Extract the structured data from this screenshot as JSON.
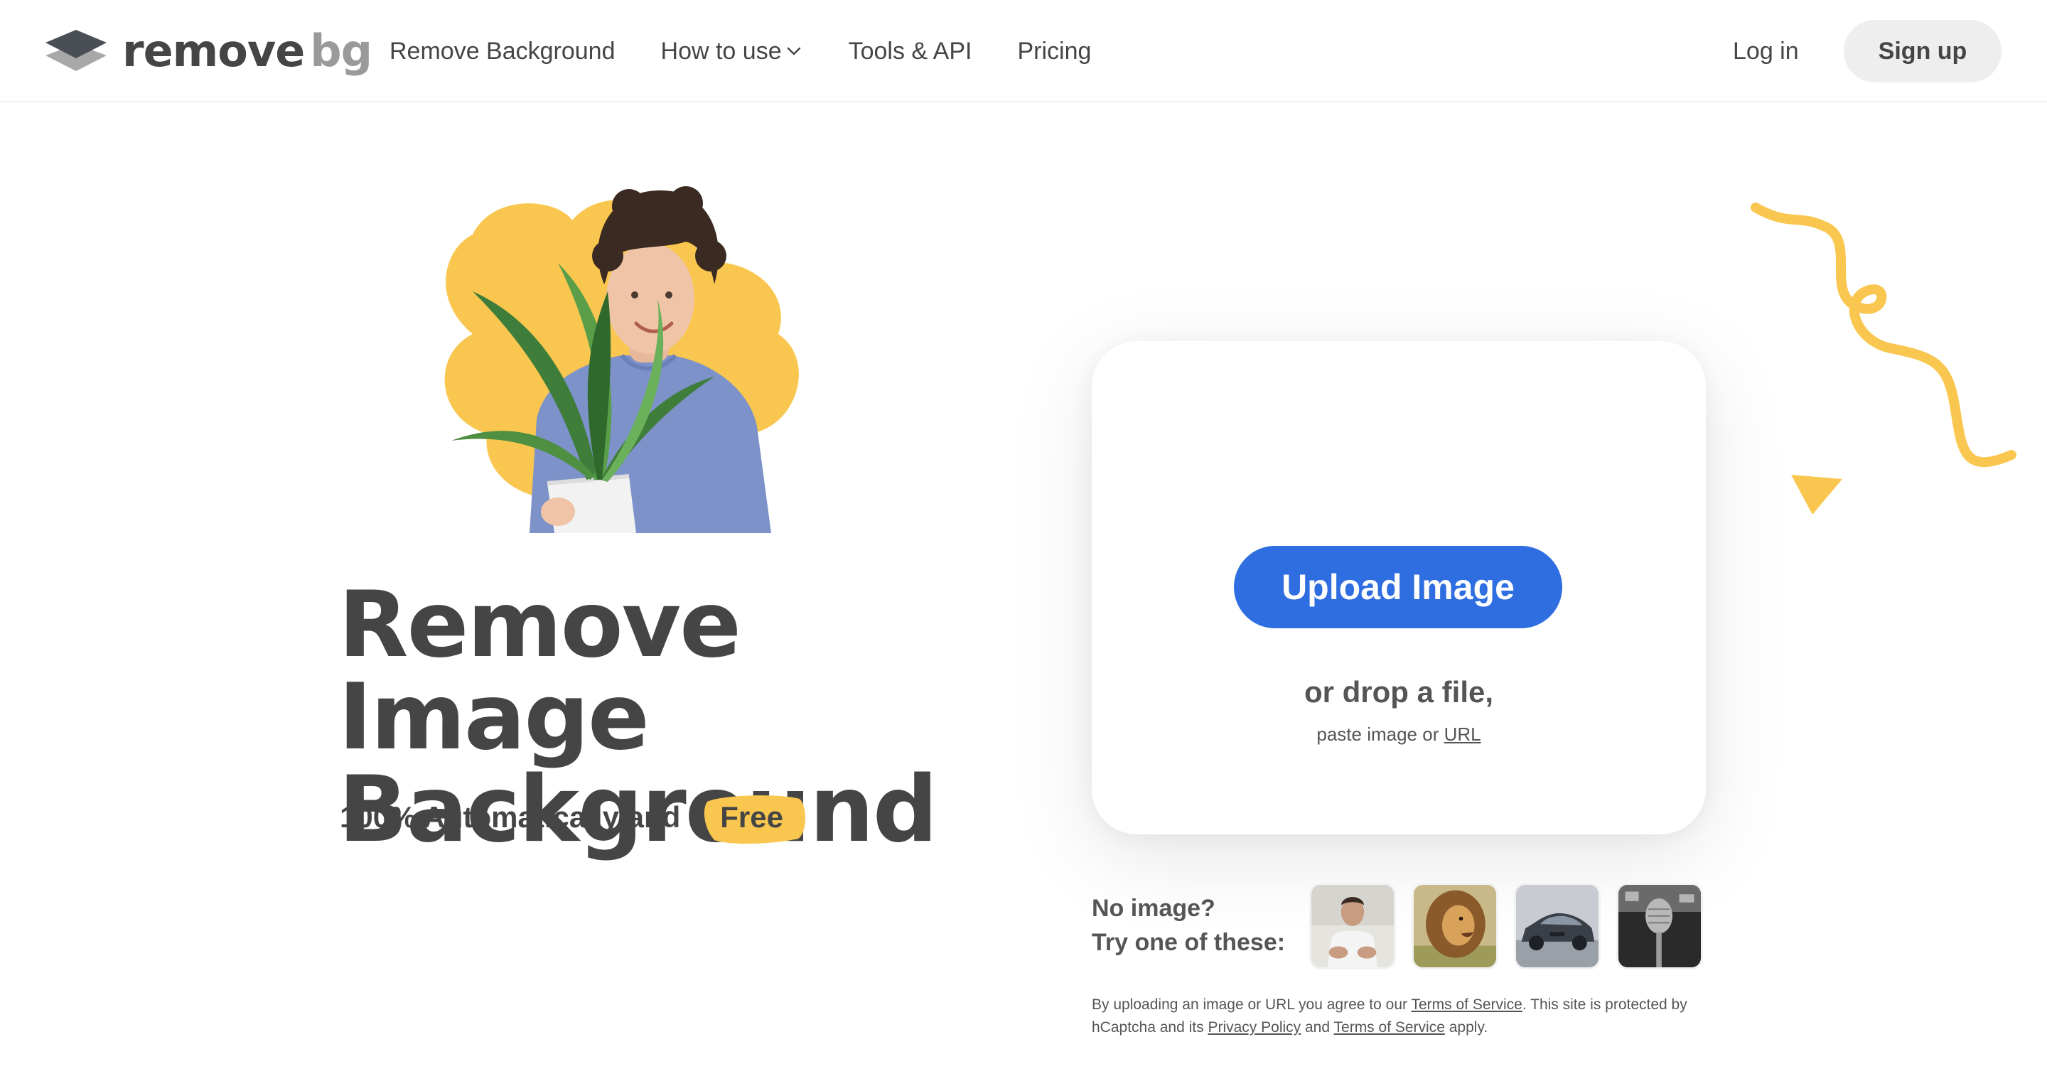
{
  "brand": {
    "logo_word1": "remove",
    "logo_word2": "bg",
    "accent_yellow": "#f9c74f",
    "primary_blue": "#2f6ee0"
  },
  "nav": {
    "items": [
      {
        "label": "Remove Background"
      },
      {
        "label": "How to use"
      },
      {
        "label": "Tools & API"
      },
      {
        "label": "Pricing"
      }
    ],
    "login_label": "Log in",
    "signup_label": "Sign up"
  },
  "hero": {
    "headline_line1": "Remove Image",
    "headline_line2": "Background",
    "sub_prefix": "100% Automatically and",
    "sub_highlight": "Free"
  },
  "upload": {
    "button_label": "Upload Image",
    "drop_text": "or drop a file,",
    "paste_prefix": "paste image or",
    "url_link": "URL"
  },
  "samples": {
    "line1": "No image?",
    "line2": "Try one of these:",
    "items": [
      {
        "icon": "person-sample-icon"
      },
      {
        "icon": "lion-sample-icon"
      },
      {
        "icon": "car-sample-icon"
      },
      {
        "icon": "microphone-sample-icon"
      }
    ]
  },
  "legal": {
    "t1": "By uploading an image or URL you agree to our",
    "tos1": "Terms of Service",
    "t2": ". This site is protected by hCaptcha and its",
    "privacy": "Privacy Policy",
    "t3": "and",
    "tos2": "Terms of Service",
    "t4": "apply."
  }
}
